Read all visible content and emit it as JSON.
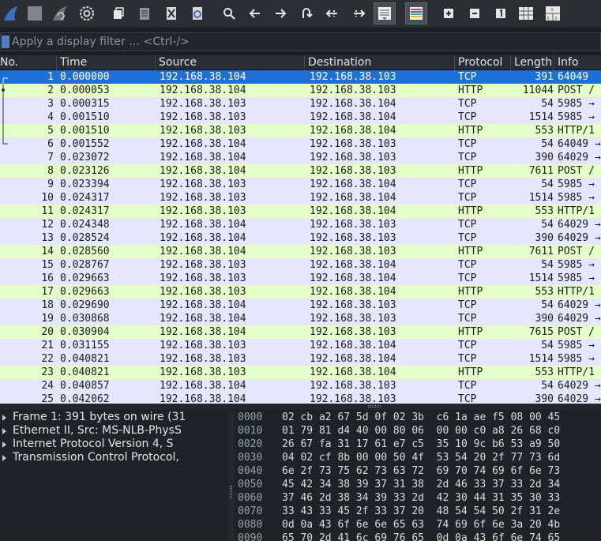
{
  "filter": {
    "placeholder": "Apply a display filter … <Ctrl-/>"
  },
  "columns": [
    "No.",
    "Time",
    "Source",
    "Destination",
    "Protocol",
    "Length",
    "Info"
  ],
  "packets": [
    {
      "no": "1",
      "time": "0.000000",
      "src": "192.168.38.104",
      "dst": "192.168.38.103",
      "proto": "TCP",
      "len": "391",
      "info": "64049"
    },
    {
      "no": "2",
      "time": "0.000053",
      "src": "192.168.38.104",
      "dst": "192.168.38.103",
      "proto": "HTTP",
      "len": "11044",
      "info": "POST /"
    },
    {
      "no": "3",
      "time": "0.000315",
      "src": "192.168.38.103",
      "dst": "192.168.38.104",
      "proto": "TCP",
      "len": "54",
      "info": "5985 →"
    },
    {
      "no": "4",
      "time": "0.001510",
      "src": "192.168.38.103",
      "dst": "192.168.38.104",
      "proto": "TCP",
      "len": "1514",
      "info": "5985 →"
    },
    {
      "no": "5",
      "time": "0.001510",
      "src": "192.168.38.103",
      "dst": "192.168.38.104",
      "proto": "HTTP",
      "len": "553",
      "info": "HTTP/1"
    },
    {
      "no": "6",
      "time": "0.001552",
      "src": "192.168.38.104",
      "dst": "192.168.38.103",
      "proto": "TCP",
      "len": "54",
      "info": "64049 →"
    },
    {
      "no": "7",
      "time": "0.023072",
      "src": "192.168.38.104",
      "dst": "192.168.38.103",
      "proto": "TCP",
      "len": "390",
      "info": "64029 →"
    },
    {
      "no": "8",
      "time": "0.023126",
      "src": "192.168.38.104",
      "dst": "192.168.38.103",
      "proto": "HTTP",
      "len": "7611",
      "info": "POST /"
    },
    {
      "no": "9",
      "time": "0.023394",
      "src": "192.168.38.103",
      "dst": "192.168.38.104",
      "proto": "TCP",
      "len": "54",
      "info": "5985 →"
    },
    {
      "no": "10",
      "time": "0.024317",
      "src": "192.168.38.103",
      "dst": "192.168.38.104",
      "proto": "TCP",
      "len": "1514",
      "info": "5985 →"
    },
    {
      "no": "11",
      "time": "0.024317",
      "src": "192.168.38.103",
      "dst": "192.168.38.104",
      "proto": "HTTP",
      "len": "553",
      "info": "HTTP/1"
    },
    {
      "no": "12",
      "time": "0.024348",
      "src": "192.168.38.104",
      "dst": "192.168.38.103",
      "proto": "TCP",
      "len": "54",
      "info": "64029 →"
    },
    {
      "no": "13",
      "time": "0.028524",
      "src": "192.168.38.104",
      "dst": "192.168.38.103",
      "proto": "TCP",
      "len": "390",
      "info": "64029 →"
    },
    {
      "no": "14",
      "time": "0.028560",
      "src": "192.168.38.104",
      "dst": "192.168.38.103",
      "proto": "HTTP",
      "len": "7611",
      "info": "POST /"
    },
    {
      "no": "15",
      "time": "0.028767",
      "src": "192.168.38.103",
      "dst": "192.168.38.104",
      "proto": "TCP",
      "len": "54",
      "info": "5985 →"
    },
    {
      "no": "16",
      "time": "0.029663",
      "src": "192.168.38.103",
      "dst": "192.168.38.104",
      "proto": "TCP",
      "len": "1514",
      "info": "5985 →"
    },
    {
      "no": "17",
      "time": "0.029663",
      "src": "192.168.38.103",
      "dst": "192.168.38.104",
      "proto": "HTTP",
      "len": "553",
      "info": "HTTP/1"
    },
    {
      "no": "18",
      "time": "0.029690",
      "src": "192.168.38.104",
      "dst": "192.168.38.103",
      "proto": "TCP",
      "len": "54",
      "info": "64029 →"
    },
    {
      "no": "19",
      "time": "0.030868",
      "src": "192.168.38.104",
      "dst": "192.168.38.103",
      "proto": "TCP",
      "len": "390",
      "info": "64029 →"
    },
    {
      "no": "20",
      "time": "0.030904",
      "src": "192.168.38.104",
      "dst": "192.168.38.103",
      "proto": "HTTP",
      "len": "7615",
      "info": "POST /"
    },
    {
      "no": "21",
      "time": "0.031155",
      "src": "192.168.38.103",
      "dst": "192.168.38.104",
      "proto": "TCP",
      "len": "54",
      "info": "5985 →"
    },
    {
      "no": "22",
      "time": "0.040821",
      "src": "192.168.38.103",
      "dst": "192.168.38.104",
      "proto": "TCP",
      "len": "1514",
      "info": "5985 →"
    },
    {
      "no": "23",
      "time": "0.040821",
      "src": "192.168.38.103",
      "dst": "192.168.38.104",
      "proto": "HTTP",
      "len": "553",
      "info": "HTTP/1"
    },
    {
      "no": "24",
      "time": "0.040857",
      "src": "192.168.38.104",
      "dst": "192.168.38.103",
      "proto": "TCP",
      "len": "54",
      "info": "64029 →"
    },
    {
      "no": "25",
      "time": "0.042062",
      "src": "192.168.38.104",
      "dst": "192.168.38.103",
      "proto": "TCP",
      "len": "390",
      "info": "64029 →"
    }
  ],
  "details": [
    "Frame 1: 391 bytes on wire (31",
    "Ethernet II, Src: MS-NLB-PhysS",
    "Internet Protocol Version 4, S",
    "Transmission Control Protocol,"
  ],
  "bytes": [
    {
      "offset": "0000",
      "hex": "02 cb a2 67 5d 0f 02 3b  c6 1a ae f5 08 00 45"
    },
    {
      "offset": "0010",
      "hex": "01 79 81 d4 40 00 80 06  00 00 c0 a8 26 68 c0"
    },
    {
      "offset": "0020",
      "hex": "26 67 fa 31 17 61 e7 c5  35 10 9c b6 53 a9 50"
    },
    {
      "offset": "0030",
      "hex": "04 02 cf 8b 00 00 50 4f  53 54 20 2f 77 73 6d"
    },
    {
      "offset": "0040",
      "hex": "6e 2f 73 75 62 73 63 72  69 70 74 69 6f 6e 73"
    },
    {
      "offset": "0050",
      "hex": "45 42 34 38 39 37 31 38  2d 46 33 37 33 2d 34"
    },
    {
      "offset": "0060",
      "hex": "37 46 2d 38 34 39 33 2d  42 30 44 31 35 30 33"
    },
    {
      "offset": "0070",
      "hex": "33 43 33 45 2f 33 37 20  48 54 54 50 2f 31 2e"
    },
    {
      "offset": "0080",
      "hex": "0d 0a 43 6f 6e 6e 65 63  74 69 6f 6e 3a 20 4b"
    },
    {
      "offset": "0090",
      "hex": "65 70 2d 41 6c 69 76 65  0d 0a 43 6f 6e 74 65"
    }
  ]
}
